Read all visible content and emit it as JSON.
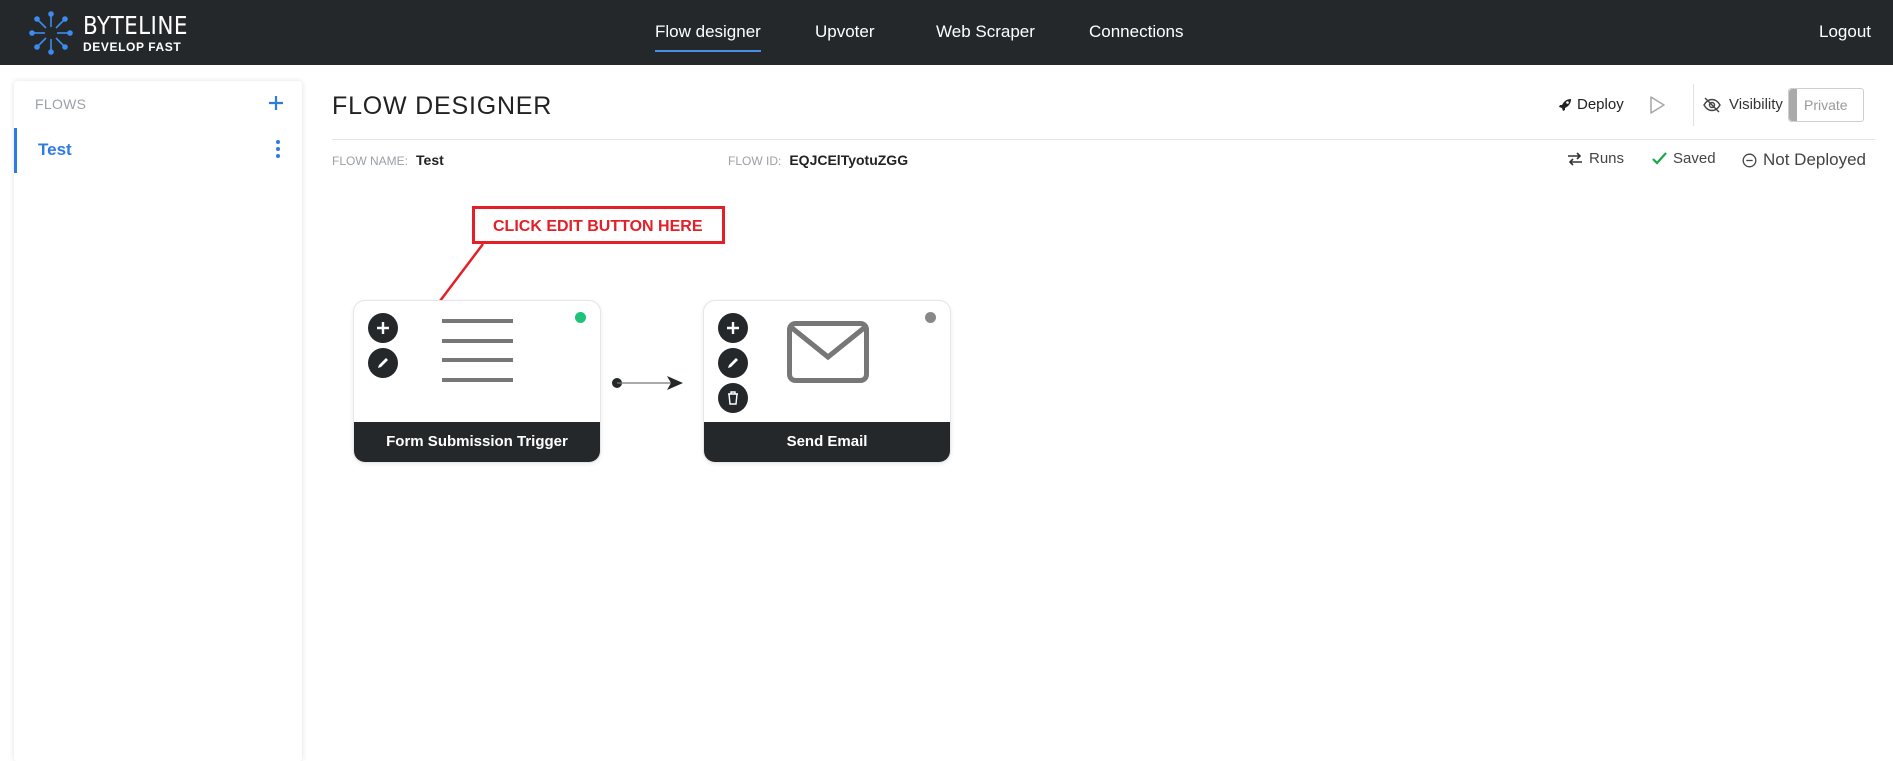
{
  "app": {
    "brand_name": "BYTELINE",
    "brand_tagline": "DEVELOP FAST"
  },
  "nav": {
    "items": [
      {
        "label": "Flow designer",
        "active": true
      },
      {
        "label": "Upvoter",
        "active": false
      },
      {
        "label": "Web Scraper",
        "active": false
      },
      {
        "label": "Connections",
        "active": false
      }
    ],
    "logout_label": "Logout"
  },
  "sidebar": {
    "header": "FLOWS",
    "add_icon": "plus-icon",
    "items": [
      {
        "label": "Test",
        "selected": true
      }
    ]
  },
  "page": {
    "title": "FLOW DESIGNER",
    "deploy_label": "Deploy",
    "visibility_label": "Visibility",
    "visibility_value": "Private"
  },
  "meta": {
    "flow_name_label": "FLOW NAME:",
    "flow_name_value": "Test",
    "flow_id_label": "FLOW ID:",
    "flow_id_value": "EQJCElTyotuZGG",
    "runs_label": "Runs",
    "saved_label": "Saved",
    "deploy_status": "Not Deployed"
  },
  "callout": {
    "text": "CLICK EDIT BUTTON HERE"
  },
  "nodes": [
    {
      "title": "Form Submission Trigger",
      "icon": "lines-icon",
      "status_color": "#1fc17b"
    },
    {
      "title": "Send Email",
      "icon": "envelope-icon",
      "status_color": "#888888"
    }
  ],
  "colors": {
    "topbar": "#25282b",
    "accent": "#2e7be6",
    "callout": "#e32027"
  }
}
